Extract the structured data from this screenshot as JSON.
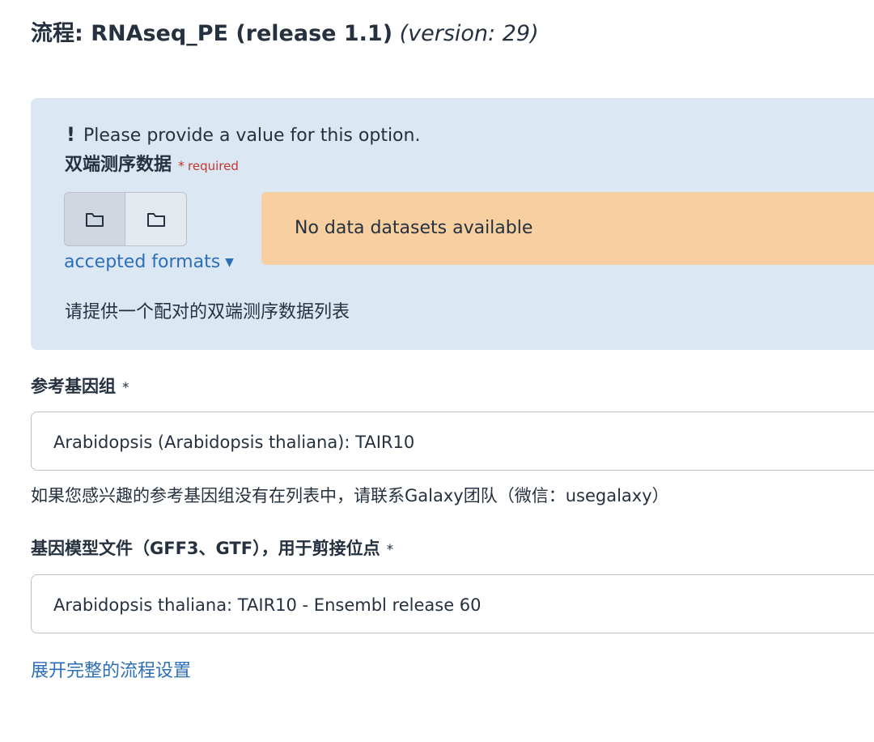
{
  "header": {
    "title_prefix": "流程: RNAseq_PE (release 1.1)",
    "version": "(version: 29)"
  },
  "paired_input": {
    "alert_icon": "!",
    "alert_text": "Please provide a value for this option.",
    "label": "双端测序数据",
    "required_star": "*",
    "required_text": "required",
    "buttons": [
      {
        "icon": "folder-icon",
        "state": "active"
      },
      {
        "icon": "folder-icon",
        "state": "normal"
      }
    ],
    "accepted_formats_label": "accepted formats",
    "caret": "▼",
    "empty_message": "No data datasets available",
    "help": "请提供一个配对的双端测序数据列表"
  },
  "reference_genome": {
    "label": "参考基因组",
    "star": "*",
    "value": "Arabidopsis (Arabidopsis thaliana): TAIR10",
    "help": "如果您感兴趣的参考基因组没有在列表中，请联系Galaxy团队（微信：usegalaxy）"
  },
  "gene_model": {
    "label": "基因模型文件（GFF3、GTF），用于剪接位点",
    "star": "*",
    "value": "Arabidopsis thaliana: TAIR10 - Ensembl release 60"
  },
  "expand_link": "展开完整的流程设置",
  "colors": {
    "panel_bg": "#dce7f4",
    "warning_bg": "#f7cfa1",
    "link": "#2c6fb4",
    "required": "#c0392b"
  }
}
